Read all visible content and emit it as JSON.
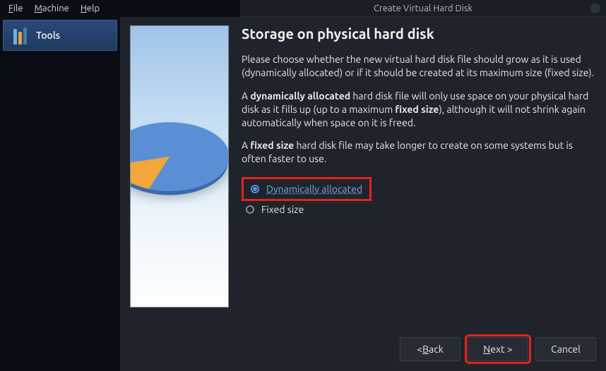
{
  "menubar": {
    "file": "File",
    "machine": "Machine",
    "help": "Help"
  },
  "titlebar": {
    "title": "Create Virtual Hard Disk"
  },
  "sidebar": {
    "tools_label": "Tools"
  },
  "dialog": {
    "heading": "Storage on physical hard disk",
    "para1": "Please choose whether the new virtual hard disk file should grow as it is used (dynamically allocated) or if it should be created at its maximum size (fixed size).",
    "para2_pre": "A ",
    "para2_b1": "dynamically allocated",
    "para2_mid": " hard disk file will only use space on your physical hard disk as it fills up (up to a maximum ",
    "para2_b2": "fixed size",
    "para2_post": "), although it will not shrink again automatically when space on it is freed.",
    "para3_pre": "A ",
    "para3_b1": "fixed size",
    "para3_post": " hard disk file may take longer to create on some systems but is often faster to use.",
    "options": {
      "dynamic": "Dynamically allocated",
      "fixed": "Fixed size",
      "selected": "dynamic"
    }
  },
  "buttons": {
    "back": "< Back",
    "next": "Next >",
    "cancel": "Cancel"
  }
}
